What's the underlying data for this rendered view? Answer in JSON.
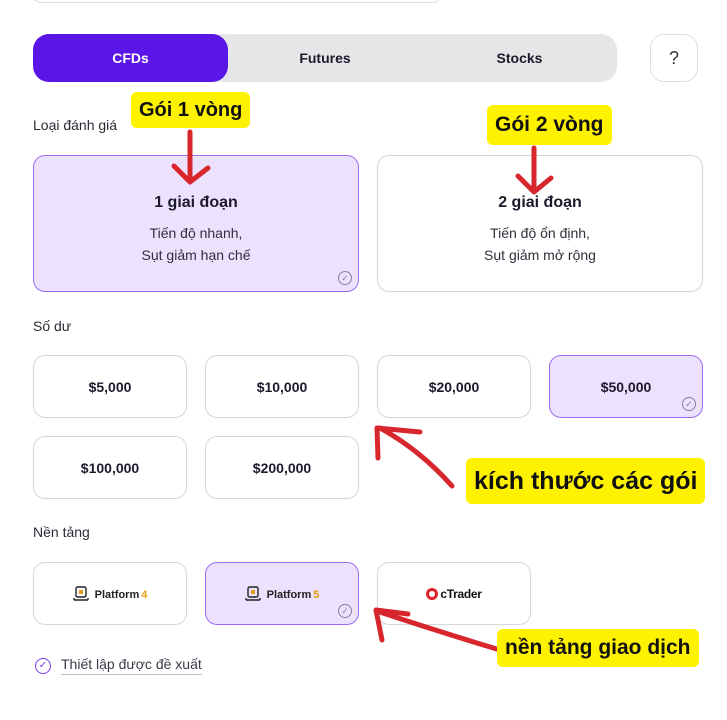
{
  "tabs": [
    {
      "label": "CFDs",
      "active": true
    },
    {
      "label": "Futures",
      "active": false
    },
    {
      "label": "Stocks",
      "active": false
    }
  ],
  "help": {
    "label": "?"
  },
  "evaluation": {
    "label": "Loại đánh giá",
    "options": [
      {
        "title": "1 giai đoạn",
        "desc": "Tiến độ nhanh,\nSụt giảm hạn chế",
        "selected": true
      },
      {
        "title": "2 giai đoạn",
        "desc": "Tiến độ ổn định,\nSụt giảm mở rộng",
        "selected": false
      }
    ]
  },
  "balance": {
    "label": "Số dư",
    "options": [
      {
        "label": "$5,000",
        "selected": false
      },
      {
        "label": "$10,000",
        "selected": false
      },
      {
        "label": "$20,000",
        "selected": false
      },
      {
        "label": "$50,000",
        "selected": true
      },
      {
        "label": "$100,000",
        "selected": false
      },
      {
        "label": "$200,000",
        "selected": false
      }
    ]
  },
  "platform": {
    "label": "Nền tảng",
    "options": [
      {
        "name": "Platform",
        "version": "4",
        "selected": false
      },
      {
        "name": "Platform",
        "version": "5",
        "selected": true
      },
      {
        "name": "cTrader",
        "version": "",
        "selected": false
      }
    ]
  },
  "recommended": {
    "label": "Thiết lập được đề xuất"
  },
  "annotations": {
    "one_round": "Gói 1 vòng",
    "two_round": "Gói 2 vòng",
    "package_size": "kích thước các gói",
    "trading_platform": "nền tảng giao dịch"
  },
  "colors": {
    "accent": "#5a16e6",
    "selected_bg": "#ede2fd",
    "annotation": "#fff200",
    "arrow": "#d7262c"
  }
}
